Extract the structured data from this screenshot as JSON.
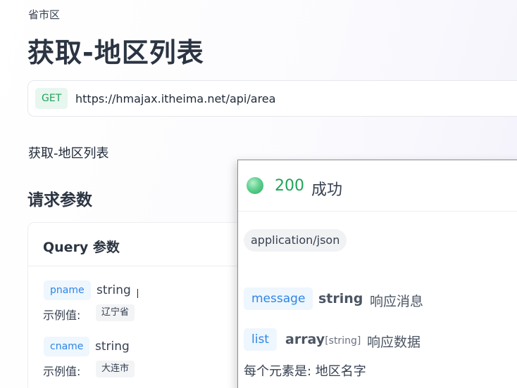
{
  "breadcrumb": "省市区",
  "title": "获取-地区列表",
  "endpoint": {
    "method": "GET",
    "url": "https://hmajax.itheima.net/api/area"
  },
  "description": "获取-地区列表",
  "params_section": {
    "title": "请求参数",
    "card_title": "Query 参数",
    "example_label": "示例值:",
    "params": [
      {
        "name": "pname",
        "type": "string",
        "example": "辽宁省"
      },
      {
        "name": "cname",
        "type": "string",
        "example": "大连市"
      }
    ]
  },
  "response": {
    "status_code": "200",
    "status_text": "成功",
    "content_type": "application/json",
    "fields": [
      {
        "name": "message",
        "type": "string",
        "type_suffix": "",
        "desc": "响应消息"
      },
      {
        "name": "list",
        "type": "array",
        "type_suffix": "[string]",
        "desc": "响应数据"
      }
    ],
    "list_note": "每个元素是: 地区名字"
  },
  "colors": {
    "get_badge_bg": "#e7f6ee",
    "get_badge_text": "#22a35a",
    "param_badge_bg": "#eef6fe",
    "param_badge_text": "#2c86e6",
    "status_success": "#22a35a"
  },
  "icons": {
    "status": "green-status-dot-icon"
  }
}
